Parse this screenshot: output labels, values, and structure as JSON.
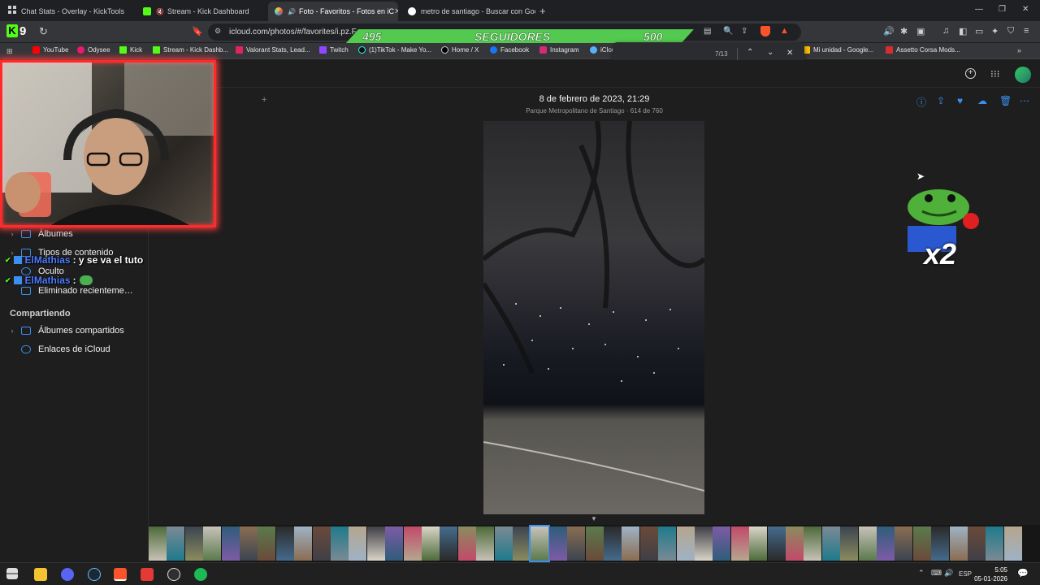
{
  "tabs": [
    {
      "title": "Chat Stats - Overlay - KickTools",
      "active": false
    },
    {
      "title": "Stream - Kick Dashboard",
      "active": false
    },
    {
      "title": "Foto - Favoritos - Fotos en iC",
      "active": true
    },
    {
      "title": "metro de santiago - Buscar con Goo",
      "active": false
    }
  ],
  "toolbar": {
    "url": "icloud.com/photos/#/favorites/i.pz.F",
    "kick_badge": "9"
  },
  "bookmarks": [
    "YouTube",
    "Odysee",
    "Kick",
    "Stream - Kick Dashb...",
    "Valorant Stats, Lead...",
    "Twitch",
    "(1)TikTok - Make Yo...",
    "Home / X",
    "Facebook",
    "Instagram",
    "iClou",
    "Mi unidad - Google...",
    "Assetto Corsa Mods..."
  ],
  "followers": {
    "current": "495",
    "label": "SEGUIDORES",
    "goal": "500"
  },
  "find": {
    "count": "7/13"
  },
  "sidebar": {
    "items": [
      {
        "label": "Álbumes"
      },
      {
        "label": "Tipos de contenido"
      },
      {
        "label": "Oculto"
      },
      {
        "label": "Eliminado recientemente"
      },
      {
        "label": "Álbumes compartidos"
      },
      {
        "label": "Enlaces de iCloud"
      }
    ],
    "section_sharing": "Compartiendo"
  },
  "photo": {
    "date": "8 de febrero de 2023, 21:29",
    "location": "Parque Metropolitano de Santiago · 614 de 760"
  },
  "chat": [
    {
      "user": "ElMathias",
      "message": ": y se va el tuto"
    },
    {
      "user": "ElMathias",
      "message": ":"
    }
  ],
  "emote": {
    "multiplier": "x2"
  },
  "taskbar": {
    "lang": "ESP",
    "time": "5:05",
    "date": "05-01-2026"
  },
  "colors": {
    "accent": "#3a8ff0",
    "kick_green": "#53fc18",
    "followbar": "#53c94f",
    "webcam_border": "#ff2b2b",
    "chat_name": "#4c7bff"
  }
}
